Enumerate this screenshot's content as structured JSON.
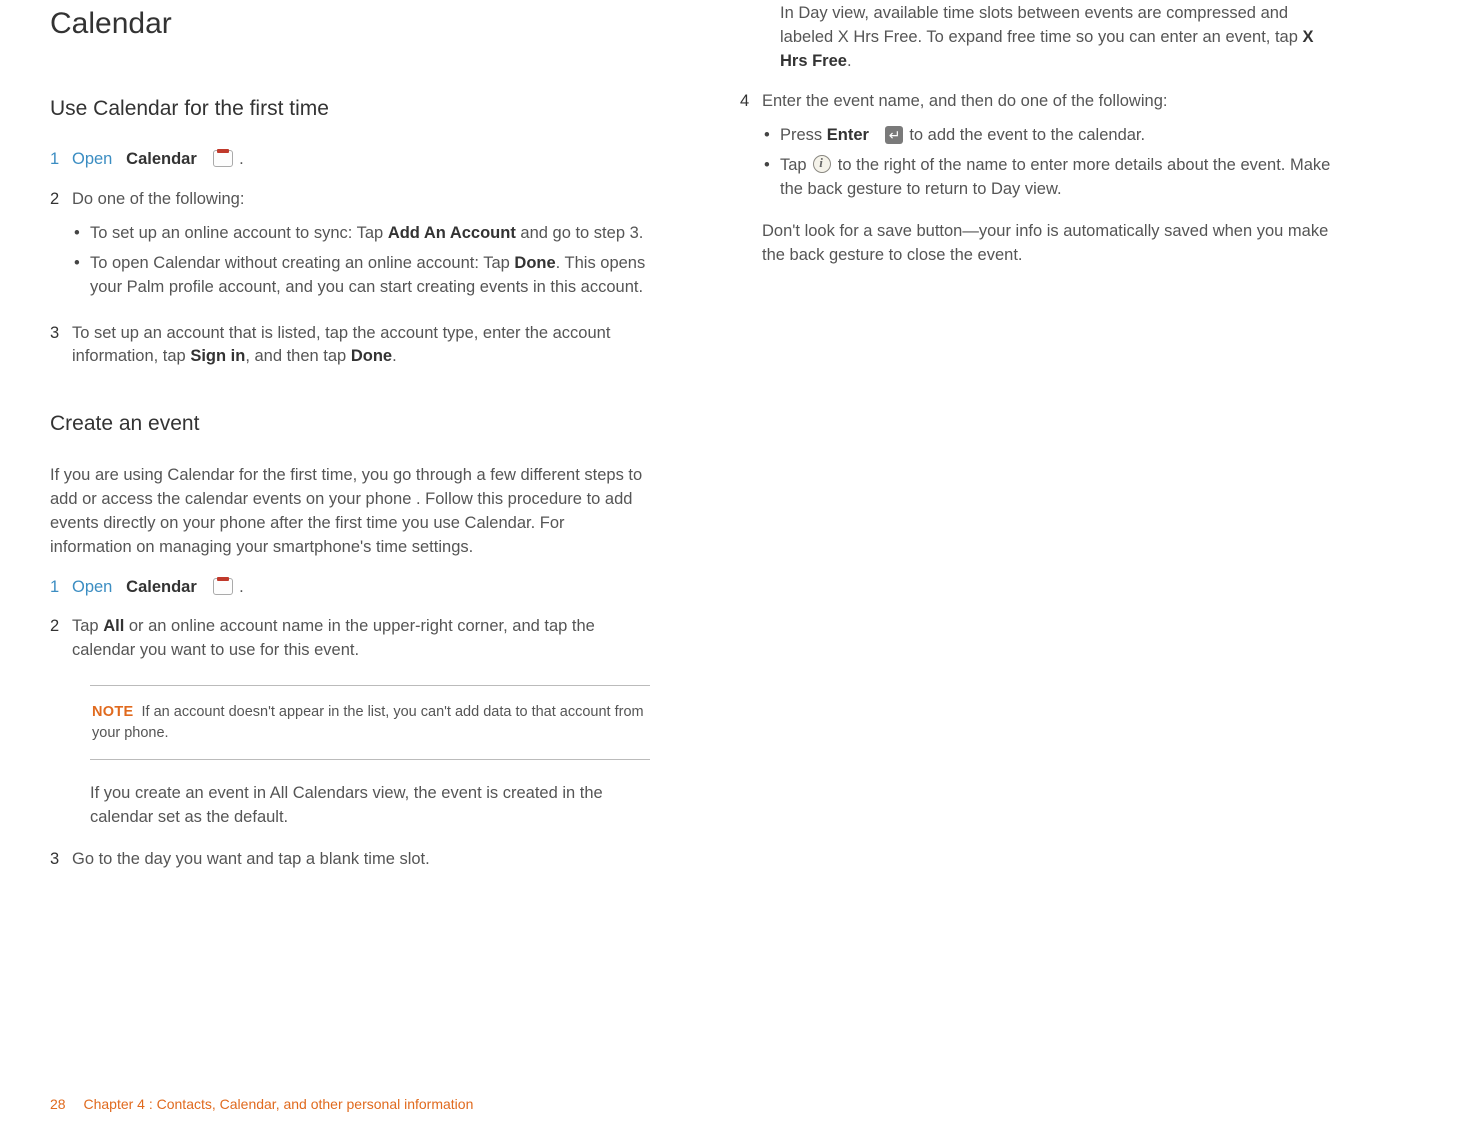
{
  "title": "Calendar",
  "section1": {
    "heading": "Use Calendar for the first time",
    "step1_num": "1",
    "step1_open": "Open",
    "step1_app": "Calendar",
    "step1_period": ".",
    "step2_num": "2",
    "step2_text": "Do one of the following:",
    "step2_bullet1_a": "To set up an online account to sync: Tap ",
    "step2_bullet1_bold": "Add An Account",
    "step2_bullet1_b": " and go to step 3.",
    "step2_bullet2_a": "To open Calendar without creating an online account: Tap ",
    "step2_bullet2_bold": "Done",
    "step2_bullet2_b": ". This opens your Palm profile account, and you can start creating events in this account.",
    "step3_num": "3",
    "step3_a": "To set up an account that is listed, tap the account type, enter the account information, tap ",
    "step3_bold1": "Sign in",
    "step3_b": ", and then tap ",
    "step3_bold2": "Done",
    "step3_c": "."
  },
  "section2": {
    "heading": "Create an event",
    "intro": "If you are using Calendar for the first time, you go through a few different steps to add or access the calendar events on your phone . Follow this procedure to add events directly on your phone after the first time you use Calendar. For information on managing your smartphone's time settings.",
    "step1_num": "1",
    "step1_open": "Open",
    "step1_app": "Calendar",
    "step1_period": ".",
    "step2_num": "2",
    "step2_a": "Tap ",
    "step2_bold": "All",
    "step2_b": " or an online account name in the upper-right corner, and tap the calendar you want to use for this event.",
    "note_label": "NOTE",
    "note_text": "If an account doesn't appear in the list, you can't add data to that account from your phone.",
    "after_note": "If you create an event in All Calendars view, the event is created in the calendar set as the default.",
    "step3_num": "3",
    "step3_text": "Go to the day you want and tap a blank time slot."
  },
  "right": {
    "para_a": "In Day view, available time slots between events are compressed and labeled X Hrs Free. To expand free time so you can enter an event, tap ",
    "para_bold": "X Hrs Free",
    "para_b": ".",
    "step4_num": "4",
    "step4_text": "Enter the event name, and then do one of the following:",
    "b1_a": "Press ",
    "b1_bold": "Enter",
    "b1_b": " to add the event to the calendar.",
    "b2_a": "Tap ",
    "b2_b": " to the right of the name to enter more details about the event. Make the back gesture to return to Day view.",
    "closing": "Don't look for a save button—your info is automatically saved when you make the back gesture to close the event."
  },
  "footer": {
    "page": "28",
    "chapter": "Chapter 4  :  Contacts, Calendar, and other personal information"
  }
}
